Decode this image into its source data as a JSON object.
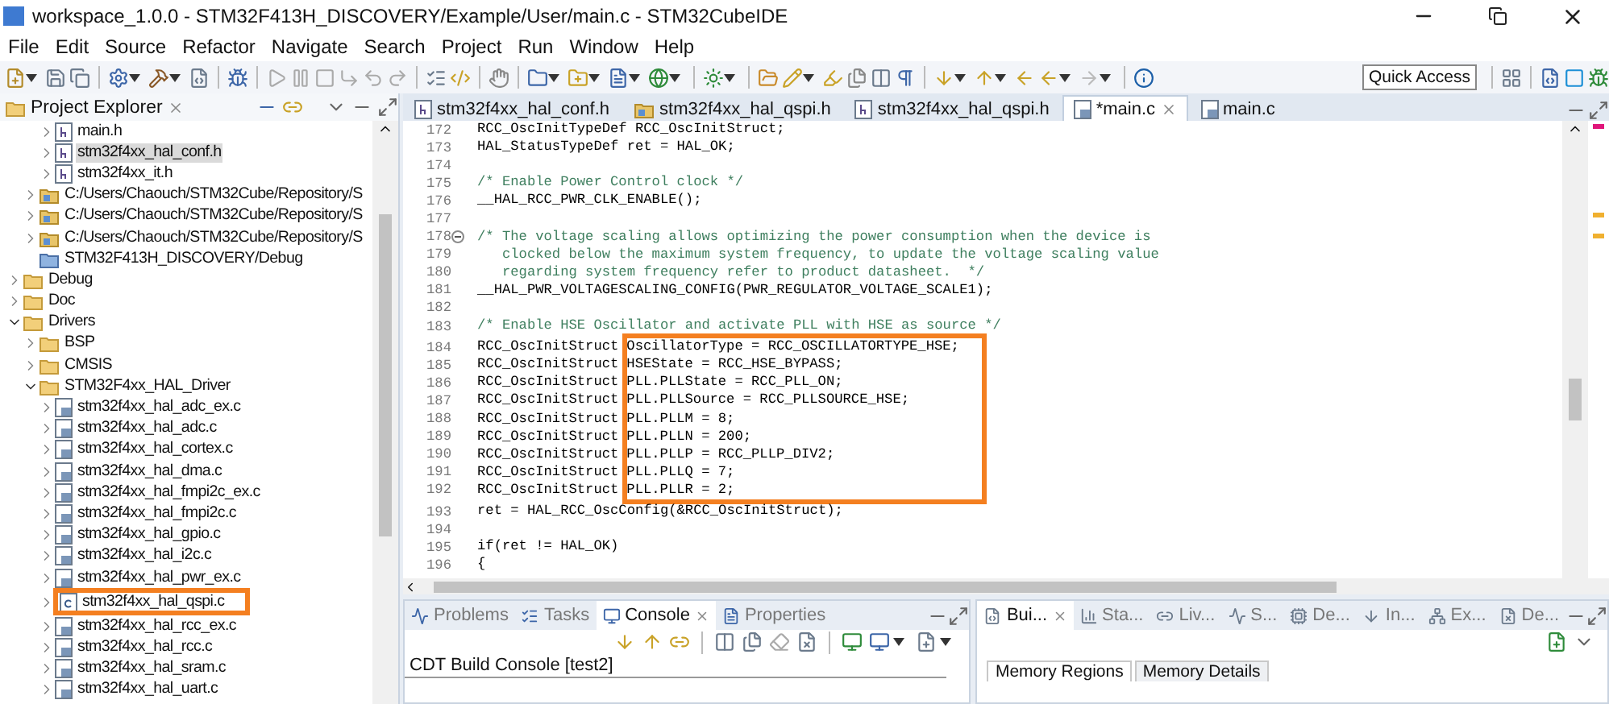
{
  "window": {
    "title": "workspace_1.0.0 - STM32F413H_DISCOVERY/Example/User/main.c - STM32CubeIDE"
  },
  "menu": [
    "File",
    "Edit",
    "Source",
    "Refactor",
    "Navigate",
    "Search",
    "Project",
    "Run",
    "Window",
    "Help"
  ],
  "toolbar": {
    "quick_access": "Quick Access"
  },
  "project_explorer": {
    "title": "Project Explorer",
    "tree": [
      {
        "children": [
          {
            "children": [
              {
                "label": "main.h",
                "kind": "header",
                "expanded": false,
                "selected": false,
                "boxed": false
              },
              {
                "label": "stm32f4xx_hal_conf.h",
                "kind": "header",
                "expanded": false,
                "selected": true,
                "boxed": false
              },
              {
                "label": "stm32f4xx_it.h",
                "kind": "header",
                "expanded": false,
                "selected": false,
                "boxed": false
              }
            ]
          },
          {
            "label": "C:/Users/Chaouch/STM32Cube/Repository/S",
            "kind": "library",
            "expanded": false,
            "selected": false,
            "boxed": false
          },
          {
            "label": "C:/Users/Chaouch/STM32Cube/Repository/S",
            "kind": "library",
            "expanded": false,
            "selected": false,
            "boxed": false
          },
          {
            "label": "C:/Users/Chaouch/STM32Cube/Repository/S",
            "kind": "library",
            "expanded": false,
            "selected": false,
            "boxed": false
          },
          {
            "label": "STM32F413H_DISCOVERY/Debug",
            "kind": "build",
            "selected": false,
            "boxed": false
          }
        ]
      },
      {
        "label": "Debug",
        "kind": "folder",
        "expanded": false,
        "selected": false,
        "boxed": false
      },
      {
        "label": "Doc",
        "kind": "folder",
        "expanded": false,
        "selected": false,
        "boxed": false
      },
      {
        "label": "Drivers",
        "kind": "folder",
        "expanded": true,
        "selected": false,
        "boxed": false,
        "children": [
          {
            "label": "BSP",
            "kind": "folder",
            "expanded": false,
            "selected": false,
            "boxed": false
          },
          {
            "label": "CMSIS",
            "kind": "folder",
            "expanded": false,
            "selected": false,
            "boxed": false
          },
          {
            "label": "STM32F4xx_HAL_Driver",
            "kind": "folder",
            "expanded": true,
            "selected": false,
            "boxed": false,
            "children": [
              {
                "label": "stm32f4xx_hal_adc_ex.c",
                "kind": "source",
                "expanded": false,
                "selected": false,
                "boxed": false
              },
              {
                "label": "stm32f4xx_hal_adc.c",
                "kind": "source",
                "expanded": false,
                "selected": false,
                "boxed": false
              },
              {
                "label": "stm32f4xx_hal_cortex.c",
                "kind": "source",
                "expanded": false,
                "selected": false,
                "boxed": false
              },
              {
                "label": "stm32f4xx_hal_dma.c",
                "kind": "source",
                "expanded": false,
                "selected": false,
                "boxed": false
              },
              {
                "label": "stm32f4xx_hal_fmpi2c_ex.c",
                "kind": "source",
                "expanded": false,
                "selected": false,
                "boxed": false
              },
              {
                "label": "stm32f4xx_hal_fmpi2c.c",
                "kind": "source",
                "expanded": false,
                "selected": false,
                "boxed": false
              },
              {
                "label": "stm32f4xx_hal_gpio.c",
                "kind": "source",
                "expanded": false,
                "selected": false,
                "boxed": false
              },
              {
                "label": "stm32f4xx_hal_i2c.c",
                "kind": "source",
                "expanded": false,
                "selected": false,
                "boxed": false
              },
              {
                "label": "stm32f4xx_hal_pwr_ex.c",
                "kind": "source",
                "expanded": false,
                "selected": false,
                "boxed": false
              },
              {
                "label": "stm32f4xx_hal_qspi.c",
                "kind": "plain_c",
                "expanded": false,
                "selected": false,
                "boxed": true
              },
              {
                "label": "stm32f4xx_hal_rcc_ex.c",
                "kind": "source",
                "expanded": false,
                "selected": false,
                "boxed": false
              },
              {
                "label": "stm32f4xx_hal_rcc.c",
                "kind": "source",
                "expanded": false,
                "selected": false,
                "boxed": false
              },
              {
                "label": "stm32f4xx_hal_sram.c",
                "kind": "source",
                "expanded": false,
                "selected": false,
                "boxed": false
              },
              {
                "label": "stm32f4xx_hal_uart.c",
                "kind": "source",
                "expanded": false,
                "selected": false,
                "boxed": false
              }
            ]
          }
        ]
      }
    ]
  },
  "editor": {
    "tabs": [
      {
        "label": "stm32f4xx_hal_conf.h",
        "kind": "header",
        "selected": false
      },
      {
        "label": "stm32f4xx_hal_qspi.h",
        "kind": "library",
        "selected": false
      },
      {
        "label": "stm32f4xx_hal_qspi.h",
        "kind": "header",
        "selected": false
      },
      {
        "label": "*main.c",
        "kind": "source",
        "selected": true
      },
      {
        "label": "main.c",
        "kind": "source",
        "selected": false
      }
    ],
    "lines": [
      {
        "number": "172",
        "kind": "code",
        "text": "RCC_OscInitTypeDef RCC_OscInitStruct;"
      },
      {
        "number": "173",
        "kind": "code",
        "text": "HAL_StatusTypeDef ret = HAL_OK;"
      },
      {
        "number": "174",
        "kind": "blank"
      },
      {
        "number": "175",
        "kind": "comment",
        "text": "/* Enable Power Control clock */"
      },
      {
        "number": "176",
        "kind": "code",
        "text": "__HAL_RCC_PWR_CLK_ENABLE();"
      },
      {
        "number": "177",
        "kind": "blank"
      },
      {
        "number": "178",
        "kind": "comment",
        "folded": false,
        "text": "/* The voltage scaling allows optimizing the power consumption when the device is"
      },
      {
        "number": "179",
        "kind": "comment",
        "text": "   clocked below the maximum system frequency, to update the voltage scaling value"
      },
      {
        "number": "180",
        "kind": "comment",
        "text": "   regarding system frequency refer to product datasheet.  */"
      },
      {
        "number": "181",
        "kind": "code",
        "text": "__HAL_PWR_VOLTAGESCALING_CONFIG(PWR_REGULATOR_VOLTAGE_SCALE1);"
      },
      {
        "number": "182",
        "kind": "blank"
      },
      {
        "number": "183",
        "kind": "comment",
        "text": "/* Enable HSE Oscillator and activate PLL with HSE as source */"
      },
      {
        "number": "184",
        "kind": "member",
        "prefix": "RCC_OscInitStruct",
        "text": "OscillatorType = RCC_OSCILLATORTYPE_HSE;"
      },
      {
        "number": "185",
        "kind": "member",
        "prefix": "RCC_OscInitStruct",
        "text": "HSEState = RCC_HSE_BYPASS;"
      },
      {
        "number": "186",
        "kind": "member",
        "prefix": "RCC_OscInitStruct",
        "text": "PLL.PLLState = RCC_PLL_ON;"
      },
      {
        "number": "187",
        "kind": "member",
        "prefix": "RCC_OscInitStruct",
        "text": "PLL.PLLSource = RCC_PLLSOURCE_HSE;"
      },
      {
        "number": "188",
        "kind": "member",
        "prefix": "RCC_OscInitStruct",
        "text": "PLL.PLLM = 8;"
      },
      {
        "number": "189",
        "kind": "member",
        "prefix": "RCC_OscInitStruct",
        "text": "PLL.PLLN = 200;"
      },
      {
        "number": "190",
        "kind": "member",
        "prefix": "RCC_OscInitStruct",
        "text": "PLL.PLLP = RCC_PLLP_DIV2;"
      },
      {
        "number": "191",
        "kind": "member",
        "prefix": "RCC_OscInitStruct",
        "text": "PLL.PLLQ = 7;"
      },
      {
        "number": "192",
        "kind": "member",
        "prefix": "RCC_OscInitStruct",
        "text": "PLL.PLLR = 2;"
      },
      {
        "number": "193",
        "kind": "code",
        "text": "ret = HAL_RCC_OscConfig(&RCC_OscInitStruct);"
      },
      {
        "number": "194",
        "kind": "blank"
      },
      {
        "number": "195",
        "kind": "code",
        "text": "if(ret != HAL_OK)"
      },
      {
        "number": "196",
        "kind": "code",
        "text": "{"
      }
    ]
  },
  "console_panel": {
    "tabs": [
      {
        "label": "Problems",
        "selected": false
      },
      {
        "label": "Tasks",
        "selected": false
      },
      {
        "label": "Console",
        "selected": true
      },
      {
        "label": "Properties",
        "selected": false
      }
    ],
    "console_title": "CDT Build Console [test2]"
  },
  "build_panel": {
    "tabs": [
      {
        "label": "Bui...",
        "selected": true
      },
      {
        "label": "Sta...",
        "selected": false
      },
      {
        "label": "Liv...",
        "selected": false
      },
      {
        "label": "S...",
        "selected": false
      },
      {
        "label": "De...",
        "selected": false
      },
      {
        "label": "In...",
        "selected": false
      },
      {
        "label": "Ex...",
        "selected": false
      },
      {
        "label": "De...",
        "selected": false
      }
    ],
    "subtabs": [
      {
        "label": "Memory Regions",
        "selected": true
      },
      {
        "label": "Memory Details",
        "selected": false
      }
    ]
  }
}
